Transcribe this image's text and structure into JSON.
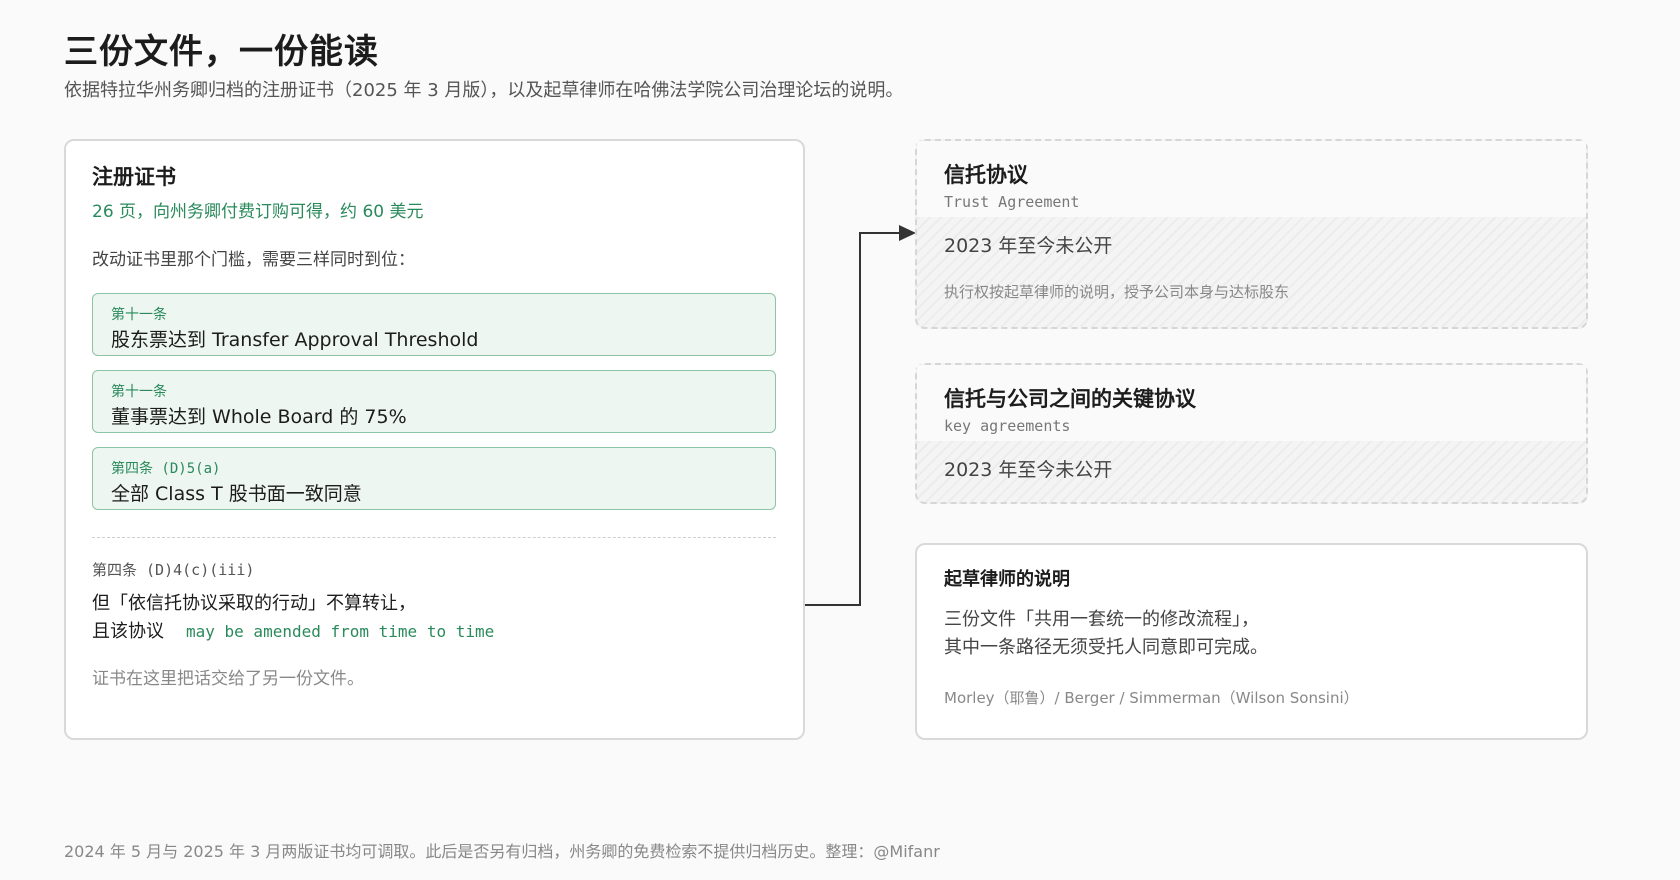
{
  "header": {
    "title": "三份文件，一份能读",
    "subtitle": "依据特拉华州务卿归档的注册证书（2025 年 3 月版），以及起草律师在哈佛法学院公司治理论坛的说明。"
  },
  "certificate": {
    "title": "注册证书",
    "meta": "26 页，向州务卿付费订购可得，约 60 美元",
    "intro": "改动证书里那个门槛，需要三样同时到位：",
    "conditions": [
      {
        "ref": "第十一条",
        "text": "股东票达到 Transfer Approval Threshold"
      },
      {
        "ref": "第十一条",
        "text": "董事票达到 Whole Board 的 75%"
      },
      {
        "ref": "第四条 (D)5(a)",
        "text": "全部 Class T 股书面一致同意"
      }
    ],
    "article": {
      "ref": "第四条 (D)4(c)(iii)",
      "line1": "但「依信托协议采取的行动」不算转让，",
      "line2_prefix": "且该协议",
      "line2_quote": "may be amended from time to time"
    },
    "handoff": "证书在这里把话交给了另一份文件。"
  },
  "trust_agreement": {
    "title": "信托协议",
    "subtitle": "Trust Agreement",
    "status": "2023 年至今未公开",
    "note": "执行权按起草律师的说明，授予公司本身与达标股东"
  },
  "key_agreements": {
    "title": "信托与公司之间的关键协议",
    "subtitle": "key agreements",
    "status": "2023 年至今未公开"
  },
  "lawyer_note": {
    "title": "起草律师的说明",
    "quote_line1": "三份文件「共用一套统一的修改流程」，",
    "quote_line2": "其中一条路径无须受托人同意即可完成。",
    "attribution": "Morley（耶鲁）/ Berger / Simmerman（Wilson Sonsini）"
  },
  "footer": {
    "text": "2024 年 5 月与 2025 年 3 月两版证书均可调取。此后是否另有归档，州务卿的免费检索不提供归档历史。整理：@Mifanr"
  },
  "colors": {
    "accent_green": "#2a8a5b",
    "condition_fill": "#eef6f1",
    "condition_border": "#8cc4a5",
    "connector": "#333333"
  }
}
